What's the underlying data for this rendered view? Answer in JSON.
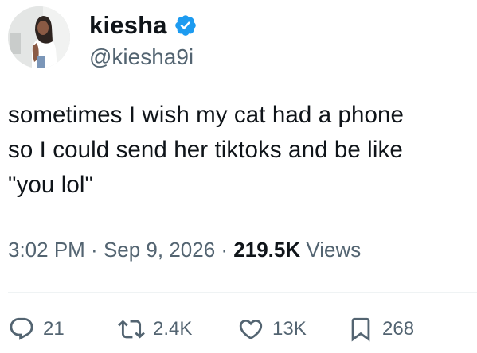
{
  "user": {
    "display_name": "kiesha",
    "handle": "@kiesha9i",
    "verified": true,
    "verified_color": "#1d9bf0"
  },
  "tweet": {
    "text": "sometimes I wish my cat had a phone\nso I could send her tiktoks and be like\n\"you lol\""
  },
  "meta": {
    "time": "3:02 PM",
    "separator": " · ",
    "date": "Sep 9, 2026",
    "views_count": "219.5K",
    "views_label": " Views"
  },
  "actions": {
    "replies": {
      "icon": "reply-icon",
      "count": "21"
    },
    "reposts": {
      "icon": "repost-icon",
      "count": "2.4K"
    },
    "likes": {
      "icon": "heart-icon",
      "count": "13K"
    },
    "bookmarks": {
      "icon": "bookmark-icon",
      "count": "268"
    }
  },
  "colors": {
    "text_primary": "#0f1419",
    "text_secondary": "#536471",
    "accent": "#1d9bf0"
  }
}
